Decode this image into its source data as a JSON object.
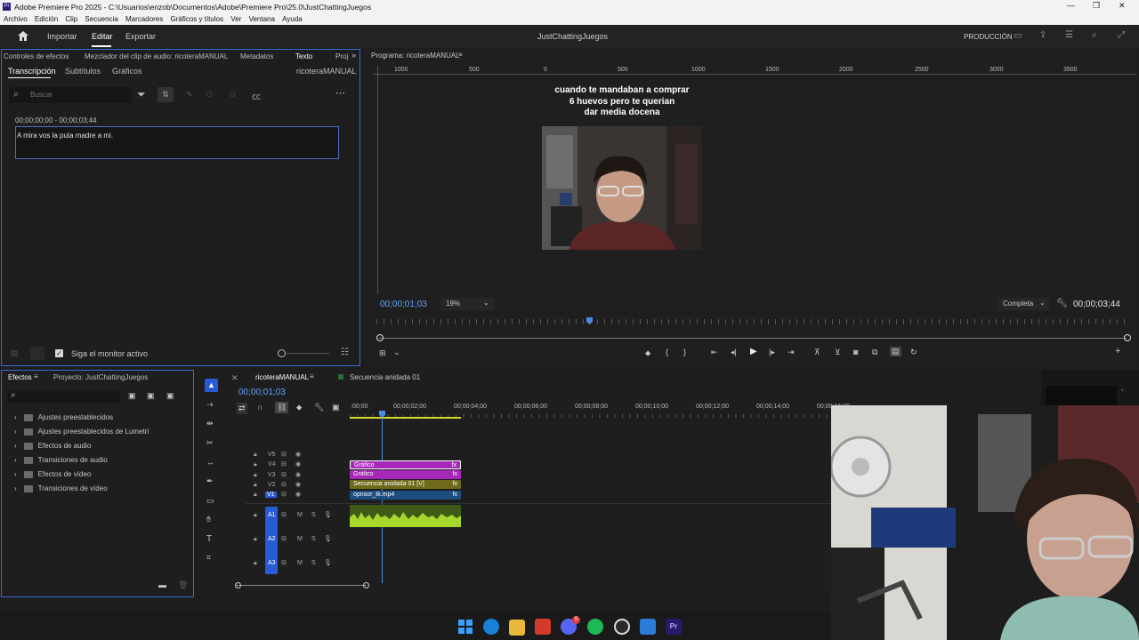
{
  "window": {
    "title": "Adobe Premiere Pro 2025 - C:\\Usuarios\\enzob\\Documentos\\Adobe\\Premiere Pro\\25.0\\JustChattingJuegos",
    "app_badge": "Pr"
  },
  "menu": [
    "Archivo",
    "Edición",
    "Clip",
    "Secuencia",
    "Marcadores",
    "Gráficos y títulos",
    "Ver",
    "Ventana",
    "Ayuda"
  ],
  "header": {
    "tabs": [
      "Importar",
      "Editar",
      "Exportar"
    ],
    "active": "Editar",
    "project_name": "JustChattingJuegos",
    "workspace": "PRODUCCIÓN"
  },
  "source_panel": {
    "tabs": [
      "Controles de efectos",
      "Mezclador del clip de audio: ricoteraMANUAL",
      "Metadatos",
      "Texto",
      "Proj"
    ],
    "subtabs": [
      "Transcripción",
      "Subtítulos",
      "Gráficos"
    ],
    "sequence": "ricoteraMANUAL",
    "search_placeholder": "Buscar",
    "segment_time": "00;00;00;00 - 00;00;03;44",
    "transcript_text": "A mira vos la puta madre a mi.",
    "follow_monitor": "Siga el monitor activo"
  },
  "program": {
    "title": "Programa: ricoteraMANUAL",
    "caption_lines": [
      "cuando te mandaban a comprar",
      "6 huevos  pero te querian",
      "dar media docena"
    ],
    "timecode": "00;00;01;03",
    "zoom": "19%",
    "quality": "Completa",
    "duration": "00;00;03;44",
    "ruler": [
      "1000",
      "500",
      "0",
      "500",
      "1000",
      "1500",
      "2000",
      "2500",
      "3000",
      "3500"
    ],
    "vruler": [
      "5",
      "0",
      "0",
      "5",
      "0",
      "0",
      "1",
      "0",
      "0",
      "0",
      "1",
      "5",
      "0",
      "0"
    ]
  },
  "effects_panel": {
    "tabs": [
      "Efectos",
      "Proyecto: JustChattingJuegos"
    ],
    "items": [
      "Ajustes preestablecidos",
      "Ajustes preestablecidos de Lumetri",
      "Efectos de audio",
      "Transiciones de audio",
      "Efectos de vídeo",
      "Transiciones de vídeo"
    ]
  },
  "timeline": {
    "tabs": [
      "ricoteraMANUAL",
      "Secuencia anidada 01"
    ],
    "timecode": "00;00;01;03",
    "ruler": [
      ":00;00",
      "00;00;02;00",
      "00;00;04;00",
      "00;00;06;00",
      "00;00;08;00",
      "00;00;10;00",
      "00;00;12;00",
      "00;00;14;00",
      "00;00;16;00"
    ],
    "video_tracks": [
      "V5",
      "V4",
      "V3",
      "V2",
      "V1"
    ],
    "audio_tracks": [
      "A1",
      "A2",
      "A3"
    ],
    "clips": [
      {
        "label": "Gráfico",
        "fx": "fx",
        "color": "#a727b8"
      },
      {
        "label": "Gráfico",
        "fx": "fx",
        "color": "#a727b8"
      },
      {
        "label": "Secuencia anidada 01 [V]",
        "fx": "fx",
        "color": "#b8a21c"
      },
      {
        "label": "opnsor_tk.mp4",
        "fx": "fx",
        "color": "#1c6aa8"
      }
    ],
    "audio_clip_color": "#4a6b1a"
  },
  "taskbar": {
    "icons": [
      "windows-start",
      "edge",
      "file-explorer",
      "video-editor",
      "discord",
      "spotify",
      "obs",
      "capture",
      "premiere"
    ],
    "badge_count": "5"
  }
}
